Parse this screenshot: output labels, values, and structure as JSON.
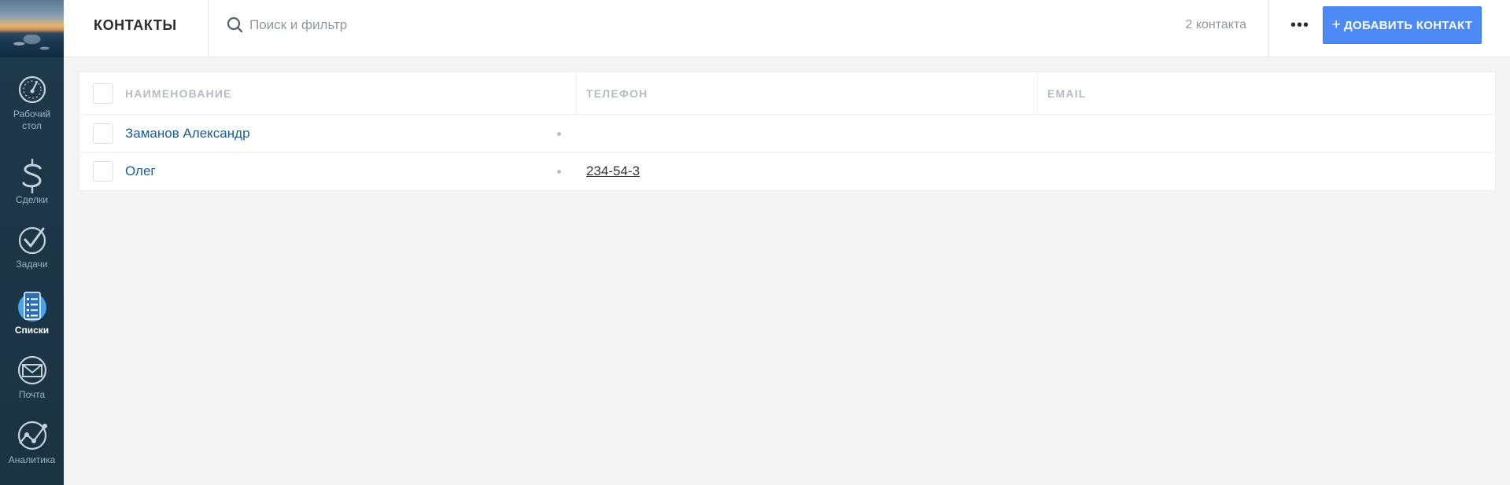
{
  "sidebar": {
    "items": [
      {
        "label_line1": "Рабочий",
        "label_line2": "стол",
        "icon": "dashboard-icon"
      },
      {
        "label": "Сделки",
        "icon": "dollar-icon"
      },
      {
        "label": "Задачи",
        "icon": "checkmark-icon"
      },
      {
        "label": "Списки",
        "icon": "list-icon",
        "active": true
      },
      {
        "label": "Почта",
        "icon": "mail-icon"
      },
      {
        "label": "Аналитика",
        "icon": "analytics-icon"
      }
    ]
  },
  "header": {
    "title": "КОНТАКТЫ",
    "search_placeholder": "Поиск и фильтр",
    "count": "2 контакта",
    "more_label": "•••",
    "add_plus": "+",
    "add_label": "ДОБАВИТЬ КОНТАКТ"
  },
  "table": {
    "columns": [
      "НАИМЕНОВАНИЕ",
      "ТЕЛЕФОН",
      "EMAIL"
    ],
    "rows": [
      {
        "name": "Заманов Александр",
        "phone": "",
        "email": ""
      },
      {
        "name": "Олег",
        "phone": "234-54-3",
        "email": ""
      }
    ]
  },
  "colors": {
    "sidebar_bg": "#1d3343",
    "accent": "#4c8bf5",
    "link": "#1a5a96"
  }
}
